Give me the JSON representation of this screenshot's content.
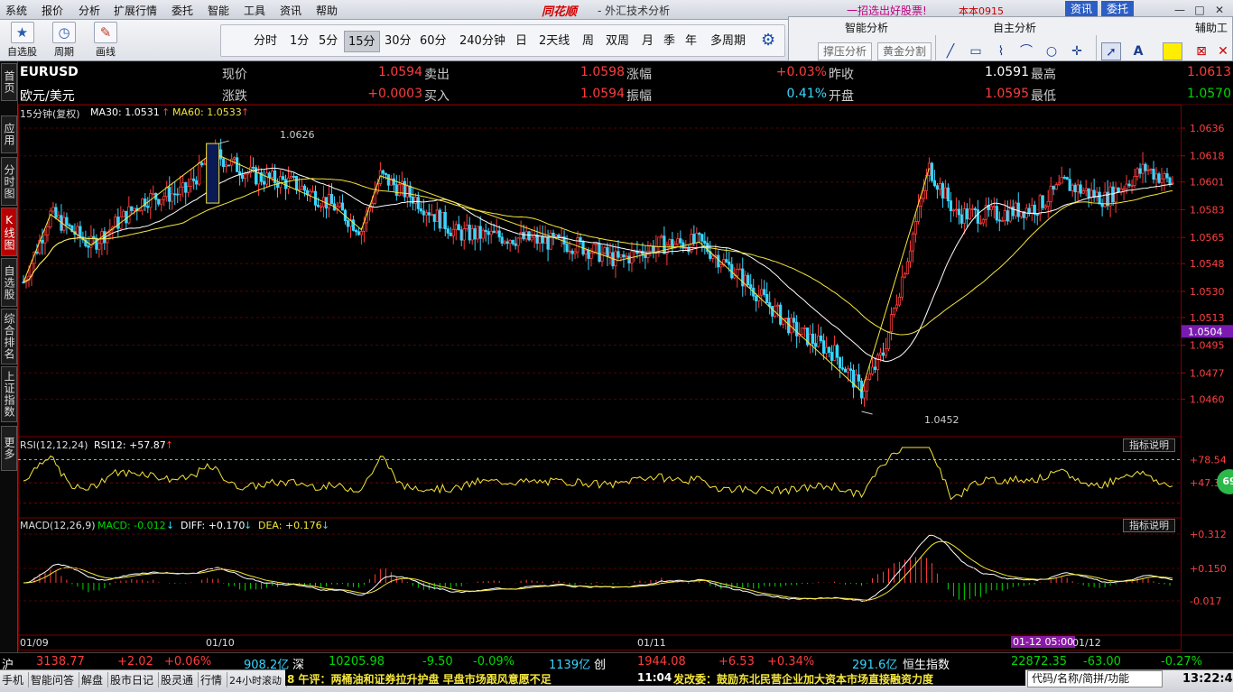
{
  "menubar": {
    "items": [
      "系统",
      "报价",
      "分析",
      "扩展行情",
      "委托",
      "智能",
      "工具",
      "资讯",
      "帮助"
    ],
    "brand": "同花顺",
    "subtitle": "- 外汇技术分析",
    "promo": "一招选出好股票!",
    "version": "本本0915",
    "btn_news": "资讯",
    "btn_trade": "委托"
  },
  "toolbar": {
    "buttons": [
      {
        "label": "自选股",
        "icon": "star-icon"
      },
      {
        "label": "周期",
        "icon": "clock-icon"
      },
      {
        "label": "画线",
        "icon": "pen-icon"
      }
    ],
    "periods": [
      "分时",
      "1分",
      "5分",
      "15分",
      "30分",
      "60分",
      "240分钟",
      "日",
      "2天线",
      "周",
      "双周",
      "月",
      "季",
      "年",
      "多周期"
    ],
    "active_period": "15分"
  },
  "analysis": {
    "smart_title": "智能分析",
    "self_title": "自主分析",
    "aux_title": "辅助工",
    "btn_support": "撑压分析",
    "btn_golden": "黄金分割"
  },
  "sidetabs": [
    "首页",
    "应用",
    "分时图",
    "K线图",
    "自选股",
    "综合排名",
    "上证指数",
    "更多"
  ],
  "quote": {
    "symbol": "EURUSD",
    "name": "欧元/美元",
    "fields": [
      {
        "label": "现价",
        "value": "1.0594",
        "color": "red"
      },
      {
        "label": "卖出",
        "value": "1.0598",
        "color": "red"
      },
      {
        "label": "涨幅",
        "value": "+0.03%",
        "color": "red"
      },
      {
        "label": "昨收",
        "value": "1.0591",
        "color": "white"
      },
      {
        "label": "最高",
        "value": "1.0613",
        "color": "red"
      },
      {
        "label": "涨跌",
        "value": "+0.0003",
        "color": "red"
      },
      {
        "label": "买入",
        "value": "1.0594",
        "color": "red"
      },
      {
        "label": "振幅",
        "value": "0.41%",
        "color": "cyan"
      },
      {
        "label": "开盘",
        "value": "1.0595",
        "color": "red"
      },
      {
        "label": "最低",
        "value": "1.0570",
        "color": "green"
      }
    ]
  },
  "kline": {
    "period_label": "15分钟(复权)",
    "ma30_label": "MA30: 1.0531",
    "ma60_label": "MA60: 1.0533",
    "high_mark": "1.0626",
    "low_mark": "1.0452",
    "price_box": "1.0504"
  },
  "rsi": {
    "label": "RSI(12,12,24)",
    "value_label": "RSI12: +57.87",
    "explain": "指标说明",
    "axis": [
      "+78.54",
      "+47.33"
    ],
    "badge": "69"
  },
  "macd": {
    "label": "MACD(12,26,9)",
    "macd_label": "MACD: -0.012",
    "diff_label": "DIFF: +0.170",
    "dea_label": "DEA: +0.176",
    "explain": "指标说明",
    "axis": [
      "+0.312",
      "+0.150",
      "-0.017"
    ]
  },
  "date_axis": {
    "labels": [
      "01/09",
      "01/10",
      "01/11",
      "01/12"
    ],
    "cursor_label": "01-12 05:00"
  },
  "chart_data": {
    "type": "candlestick",
    "ylim": [
      1.0452,
      1.0636
    ],
    "y_ticks": [
      "1.0636",
      "1.0618",
      "1.0601",
      "1.0583",
      "1.0565",
      "1.0548",
      "1.0530",
      "1.0513",
      "1.0495",
      "1.0477",
      "1.0460"
    ],
    "x_labels": [
      "01/09",
      "01/10",
      "01/11",
      "01/12"
    ],
    "anchors": [
      [
        0,
        1.0536
      ],
      [
        10,
        1.058
      ],
      [
        25,
        1.056
      ],
      [
        45,
        1.059
      ],
      [
        60,
        1.0595
      ],
      [
        70,
        1.062
      ],
      [
        85,
        1.0605
      ],
      [
        100,
        1.06
      ],
      [
        115,
        1.0585
      ],
      [
        125,
        1.057
      ],
      [
        132,
        1.0605
      ],
      [
        145,
        1.059
      ],
      [
        160,
        1.0568
      ],
      [
        180,
        1.0565
      ],
      [
        205,
        1.056
      ],
      [
        220,
        1.055
      ],
      [
        235,
        1.056
      ],
      [
        250,
        1.0562
      ],
      [
        265,
        1.054
      ],
      [
        285,
        1.0505
      ],
      [
        300,
        1.049
      ],
      [
        310,
        1.0465
      ],
      [
        318,
        1.049
      ],
      [
        328,
        1.056
      ],
      [
        335,
        1.061
      ],
      [
        345,
        1.058
      ],
      [
        360,
        1.058
      ],
      [
        375,
        1.0585
      ],
      [
        385,
        1.06
      ],
      [
        400,
        1.059
      ],
      [
        415,
        1.061
      ],
      [
        425,
        1.06
      ]
    ],
    "series": [
      {
        "name": "MA30",
        "color": "#ffffff"
      },
      {
        "name": "MA60",
        "color": "#f5e63c"
      }
    ]
  },
  "index_bar": [
    {
      "text": "沪",
      "color": "white"
    },
    {
      "text": "3138.77",
      "color": "red"
    },
    {
      "text": "+2.02",
      "color": "red"
    },
    {
      "text": "+0.06%",
      "color": "red"
    },
    {
      "text": "908.2亿",
      "color": "cyan"
    },
    {
      "text": "深",
      "color": "white"
    },
    {
      "text": "10205.98",
      "color": "green"
    },
    {
      "text": "-9.50",
      "color": "green"
    },
    {
      "text": "-0.09%",
      "color": "green"
    },
    {
      "text": "1139亿",
      "color": "cyan"
    },
    {
      "text": "创",
      "color": "white"
    },
    {
      "text": "1944.08",
      "color": "red"
    },
    {
      "text": "+6.53",
      "color": "red"
    },
    {
      "text": "+0.34%",
      "color": "red"
    },
    {
      "text": "291.6亿",
      "color": "cyan"
    },
    {
      "text": "恒生指数",
      "color": "white"
    },
    {
      "text": "22872.35",
      "color": "green"
    },
    {
      "text": "-63.00",
      "color": "green"
    },
    {
      "text": "-0.27%",
      "color": "green"
    }
  ],
  "statusbar": {
    "items": [
      "手机",
      "智能问答",
      "解盘",
      "股市日记",
      "股灵通",
      "行情",
      "24小时滚动"
    ],
    "news1": "8 午评：两桶油和证券拉升护盘 早盘市场跟风意愿不足",
    "news2_time": "11:04",
    "news2": "发改委：鼓励东北民营企业加大资本市场直接融资力度",
    "search_placeholder": "代码/名称/简拼/功能",
    "clock": "13:22:48"
  }
}
